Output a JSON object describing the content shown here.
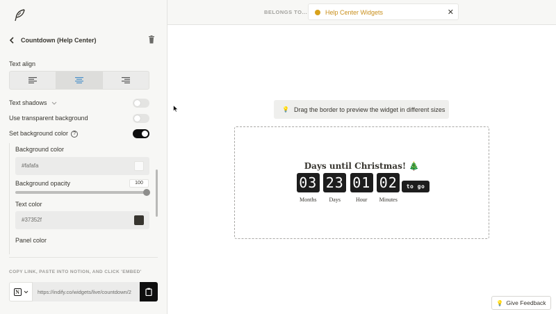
{
  "sidebar": {
    "back_title": "Countdown (Help Center)",
    "text_align_label": "Text align",
    "text_shadows_label": "Text shadows",
    "text_shadows_on": false,
    "transparent_bg_label": "Use transparent background",
    "transparent_bg_on": false,
    "set_bg_label": "Set background color",
    "set_bg_on": true,
    "help_glyph": "?",
    "background_color_label": "Background color",
    "background_color_value": "#fafafa",
    "background_opacity_label": "Background opacity",
    "background_opacity_value": "100",
    "text_color_label": "Text color",
    "text_color_value": "#37352f",
    "panel_color_label": "Panel color",
    "embed_label": "COPY LINK, PASTE INTO NOTION, AND CLICK 'EMBED'",
    "embed_url": "https://indify.co/widgets/live/countdown/2",
    "notion_glyph": "N"
  },
  "topbar": {
    "belongs_label": "BELONGS TO...",
    "belongs_value": "Help Center Widgets",
    "close_glyph": "✕",
    "accent_color": "#d8a21c"
  },
  "preview": {
    "hint": "Drag the border to preview the widget in different sizes",
    "hint_icon": "💡"
  },
  "widget": {
    "title": "Days until Christmas! 🎄",
    "units": [
      {
        "value": "03",
        "label": "Months"
      },
      {
        "value": "23",
        "label": "Days"
      },
      {
        "value": "01",
        "label": "Hour"
      },
      {
        "value": "02",
        "label": "Minutes"
      }
    ],
    "suffix": "to go"
  },
  "feedback": {
    "label": "Give Feedback",
    "icon": "💡"
  }
}
